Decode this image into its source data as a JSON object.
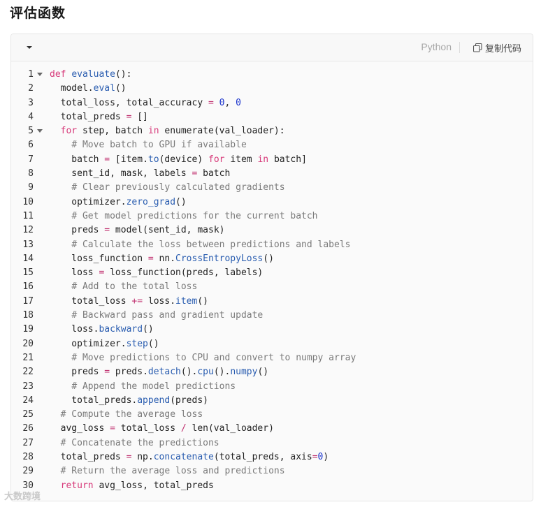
{
  "heading": "评估函数",
  "toolbar": {
    "language": "Python",
    "copy_label": "复制代码",
    "collapse_icon": "chevron-down-icon",
    "copy_icon": "copy-icon"
  },
  "watermark": "大数跨境",
  "code_lines": [
    {
      "n": "1",
      "fold": true,
      "html": "<span class='kw'>def</span> <span class='fn'>evaluate</span>():"
    },
    {
      "n": "2",
      "html": "  model.<span class='fn'>eval</span>()"
    },
    {
      "n": "3",
      "html": "  total_loss, total_accuracy <span class='op'>=</span> <span class='num'>0</span>, <span class='num'>0</span>"
    },
    {
      "n": "4",
      "html": "  total_preds <span class='op'>=</span> []"
    },
    {
      "n": "5",
      "fold": true,
      "html": "  <span class='kw'>for</span> step, batch <span class='kw'>in</span> enumerate(val_loader):"
    },
    {
      "n": "6",
      "html": "    <span class='cm'># Move batch to GPU if available</span>"
    },
    {
      "n": "7",
      "html": "    batch <span class='op'>=</span> [item.<span class='fn'>to</span>(device) <span class='kw'>for</span> item <span class='kw'>in</span> batch]"
    },
    {
      "n": "8",
      "html": "    sent_id, mask, labels <span class='op'>=</span> batch"
    },
    {
      "n": "9",
      "html": "    <span class='cm'># Clear previously calculated gradients</span>"
    },
    {
      "n": "10",
      "html": "    optimizer.<span class='fn'>zero_grad</span>()"
    },
    {
      "n": "11",
      "html": "    <span class='cm'># Get model predictions for the current batch</span>"
    },
    {
      "n": "12",
      "html": "    preds <span class='op'>=</span> model(sent_id, mask)"
    },
    {
      "n": "13",
      "html": "    <span class='cm'># Calculate the loss between predictions and labels</span>"
    },
    {
      "n": "14",
      "html": "    loss_function <span class='op'>=</span> nn.<span class='fn'>CrossEntropyLoss</span>()"
    },
    {
      "n": "15",
      "html": "    loss <span class='op'>=</span> loss_function(preds, labels)"
    },
    {
      "n": "16",
      "html": "    <span class='cm'># Add to the total loss</span>"
    },
    {
      "n": "17",
      "html": "    total_loss <span class='op'>+=</span> loss.<span class='fn'>item</span>()"
    },
    {
      "n": "18",
      "html": "    <span class='cm'># Backward pass and gradient update</span>"
    },
    {
      "n": "19",
      "html": "    loss.<span class='fn'>backward</span>()"
    },
    {
      "n": "20",
      "html": "    optimizer.<span class='fn'>step</span>()"
    },
    {
      "n": "21",
      "html": "    <span class='cm'># Move predictions to CPU and convert to numpy array</span>"
    },
    {
      "n": "22",
      "html": "    preds <span class='op'>=</span> preds.<span class='fn'>detach</span>().<span class='fn'>cpu</span>().<span class='fn'>numpy</span>()"
    },
    {
      "n": "23",
      "html": "    <span class='cm'># Append the model predictions</span>"
    },
    {
      "n": "24",
      "html": "    total_preds.<span class='fn'>append</span>(preds)"
    },
    {
      "n": "25",
      "html": "  <span class='cm'># Compute the average loss</span>"
    },
    {
      "n": "26",
      "html": "  avg_loss <span class='op'>=</span> total_loss <span class='op'>/</span> len(val_loader)"
    },
    {
      "n": "27",
      "html": "  <span class='cm'># Concatenate the predictions</span>"
    },
    {
      "n": "28",
      "html": "  total_preds <span class='op'>=</span> np.<span class='fn'>concatenate</span>(total_preds, axis<span class='op'>=</span><span class='num'>0</span>)"
    },
    {
      "n": "29",
      "html": "  <span class='cm'># Return the average loss and predictions</span>"
    },
    {
      "n": "30",
      "html": "  <span class='kw'>return</span> avg_loss, total_preds"
    }
  ]
}
